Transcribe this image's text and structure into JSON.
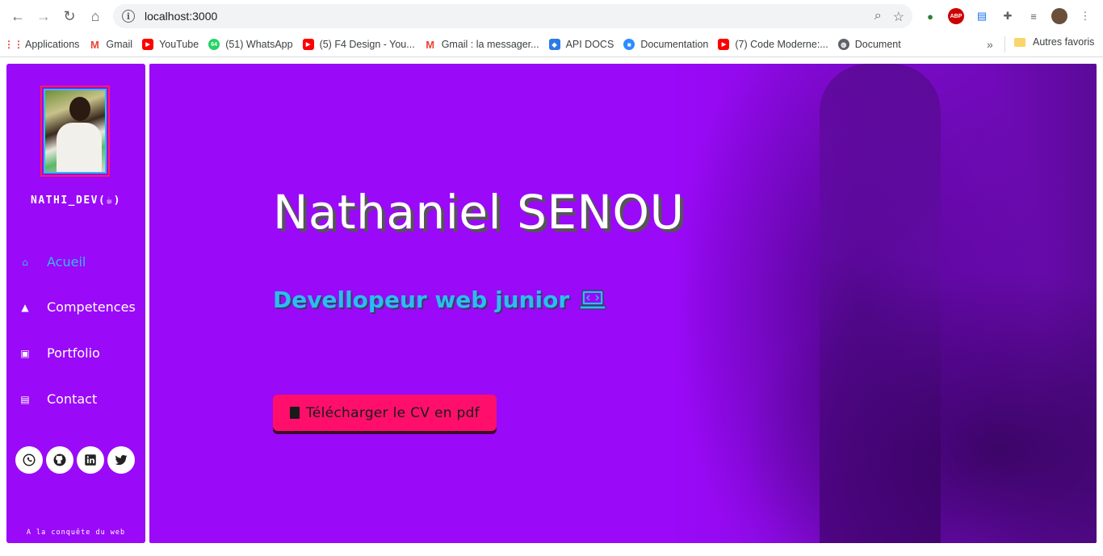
{
  "browser": {
    "url": "localhost:3000",
    "bookmarks": [
      {
        "label": "Applications",
        "icon": "apps-grid-icon",
        "color": "#ea4335"
      },
      {
        "label": "Gmail",
        "icon": "gmail-icon",
        "color": "#ea4335"
      },
      {
        "label": "YouTube",
        "icon": "youtube-icon",
        "color": "#ff0000"
      },
      {
        "label": "(51) WhatsApp",
        "icon": "whatsapp-icon",
        "color": "#25d366",
        "badge": "64"
      },
      {
        "label": "(5) F4 Design - You...",
        "icon": "youtube-icon",
        "color": "#ff0000"
      },
      {
        "label": "Gmail : la messager...",
        "icon": "gmail-icon",
        "color": "#ea4335"
      },
      {
        "label": "API DOCS",
        "icon": "api-docs-icon",
        "color": "#2c7be5"
      },
      {
        "label": "Documentation",
        "icon": "zoom-icon",
        "color": "#2d8cff"
      },
      {
        "label": "(7) Code Moderne:...",
        "icon": "youtube-icon",
        "color": "#ff0000"
      },
      {
        "label": "Document",
        "icon": "globe-icon",
        "color": "#5f6368"
      }
    ],
    "more_label": "»",
    "other_bookmarks": "Autres favoris"
  },
  "sidebar": {
    "brand": "NATHI_DEV(☕)",
    "menu": [
      {
        "label": "Acueil",
        "icon": "home-icon",
        "active": true
      },
      {
        "label": "Competences",
        "icon": "mountain-icon",
        "active": false
      },
      {
        "label": "Portfolio",
        "icon": "images-icon",
        "active": false
      },
      {
        "label": "Contact",
        "icon": "address-book-icon",
        "active": false
      }
    ],
    "socials": [
      "whatsapp-icon",
      "github-icon",
      "linkedin-icon",
      "twitter-icon"
    ],
    "tagline": "A la conquête du web"
  },
  "hero": {
    "title": "Nathaniel SENOU",
    "subtitle": "Devellopeur web junior",
    "cv_button": "Télécharger le CV en pdf"
  },
  "colors": {
    "accent": "#9a09f8",
    "button": "#ff0f6b",
    "highlight": "#2bbdf1"
  }
}
